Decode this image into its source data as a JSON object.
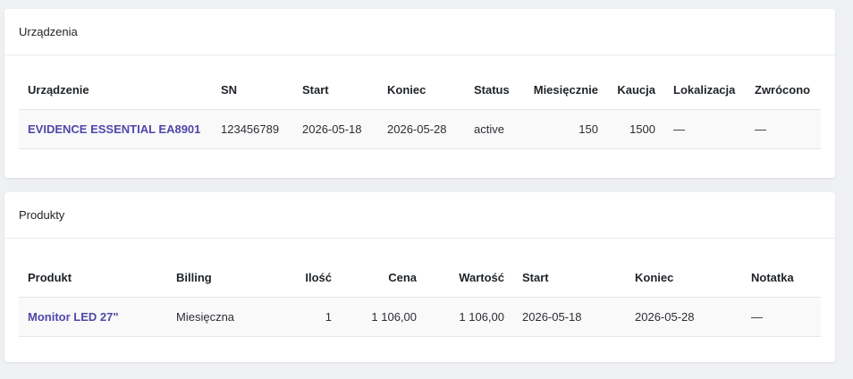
{
  "devices": {
    "title": "Urządzenia",
    "columns": [
      "Urządzenie",
      "SN",
      "Start",
      "Koniec",
      "Status",
      "Miesięcznie",
      "Kaucja",
      "Lokalizacja",
      "Zwrócono"
    ],
    "rows": [
      {
        "device": "EVIDENCE ESSENTIAL EA8901",
        "sn": "123456789",
        "start": "2026-05-18",
        "end": "2026-05-28",
        "status": "active",
        "monthly": "150",
        "deposit": "1500",
        "location": "—",
        "returned": "—"
      }
    ]
  },
  "products": {
    "title": "Produkty",
    "columns": [
      "Produkt",
      "Billing",
      "Ilość",
      "Cena",
      "Wartość",
      "Start",
      "Koniec",
      "Notatka"
    ],
    "rows": [
      {
        "product": "Monitor LED 27\"",
        "billing": "Miesięczna",
        "qty": "1",
        "price": "1 106,00",
        "value": "1 106,00",
        "start": "2026-05-18",
        "end": "2026-05-28",
        "note": "—"
      }
    ]
  },
  "colors": {
    "link": "#5147a8",
    "background": "#eef0f3",
    "row_background": "#f9f9fa"
  }
}
